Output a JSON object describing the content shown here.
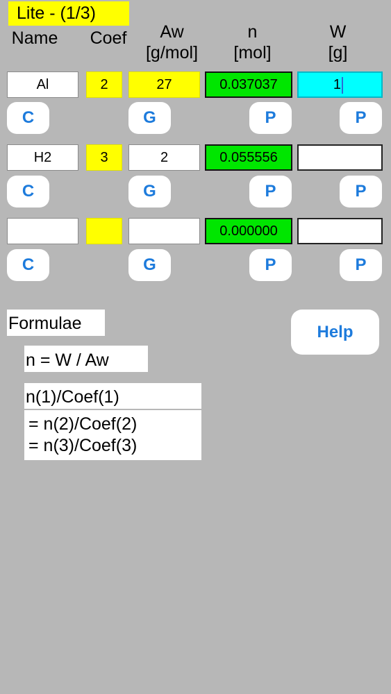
{
  "title": "Lite - (1/3)",
  "headers": {
    "name": "Name",
    "coef": "Coef",
    "aw_line1": "Aw",
    "aw_line2": "[g/mol]",
    "n_line1": "n",
    "n_line2": "[mol]",
    "w_line1": "W",
    "w_line2": "[g]"
  },
  "rows": [
    {
      "name": "Al",
      "coef": "2",
      "aw": "27",
      "n": "0.037037",
      "w": "1"
    },
    {
      "name": "H2",
      "coef": "3",
      "aw": "2",
      "n": "0.055556",
      "w": ""
    },
    {
      "name": "",
      "coef": "",
      "aw": "",
      "n": "0.000000",
      "w": ""
    }
  ],
  "buttons": {
    "c": "C",
    "g": "G",
    "p": "P",
    "help": "Help"
  },
  "formulae": {
    "label": "Formulae",
    "f1": "n = W / Aw",
    "f2_line1": "n(1)/Coef(1)",
    "f2_line2": "= n(2)/Coef(2)",
    "f2_line3": "= n(3)/Coef(3)"
  },
  "colors": {
    "background": "#b7b7b7",
    "title_badge": "#ffff00",
    "coef_field": "#ffff00",
    "moles_field": "#00e600",
    "active_field": "#00ffff",
    "button_text": "#1d7bdc"
  }
}
